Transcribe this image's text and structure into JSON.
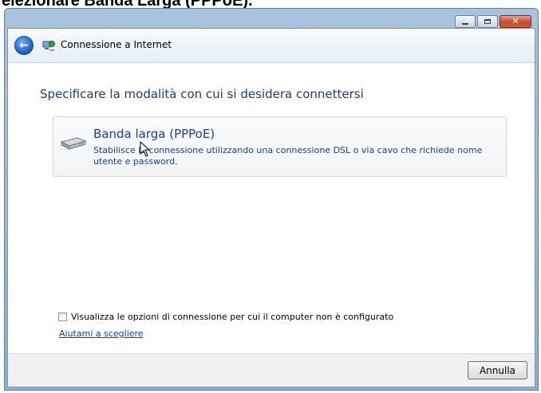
{
  "page_caption": "elezionare Banda Larga (PPPoE).",
  "window": {
    "title": "Connessione a Internet",
    "heading": "Specificare la modalità con cui si desidera connettersi"
  },
  "option": {
    "title": "Banda larga (PPPoE)",
    "description": "Stabilisce la connessione utilizzando una connessione DSL o via cavo che richiede nome utente e password."
  },
  "checkbox": {
    "label": "Visualizza le opzioni di connessione per cui il computer non è configurato",
    "checked": false
  },
  "help_link": "Aiutami a scegliere",
  "footer": {
    "cancel_label": "Annulla"
  },
  "icons": {
    "back": "back-arrow-icon",
    "network": "network-icon",
    "modem": "broadband-modem-icon"
  }
}
